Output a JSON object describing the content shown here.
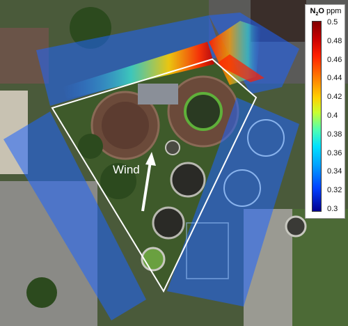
{
  "image": {
    "description_labels": {
      "wind_label": "Wind"
    }
  },
  "colorbar": {
    "title_main": "N",
    "title_sub": "2",
    "title_rest": "O",
    "unit": "ppm",
    "ticks": [
      "0.5",
      "0.48",
      "0.46",
      "0.44",
      "0.42",
      "0.4",
      "0.38",
      "0.36",
      "0.34",
      "0.32",
      "0.3"
    ],
    "range": [
      0.3,
      0.5
    ],
    "colormap": [
      "#000090",
      "#0040ff",
      "#00a0ff",
      "#00e0ff",
      "#50ffb0",
      "#c8ff30",
      "#ffd000",
      "#ff8000",
      "#ff2000",
      "#c80000",
      "#800000"
    ]
  },
  "colors": {
    "overlay_blue": "#1e64ff",
    "boundary_line": "#ffffff",
    "wind_arrow": "#ffffff"
  }
}
